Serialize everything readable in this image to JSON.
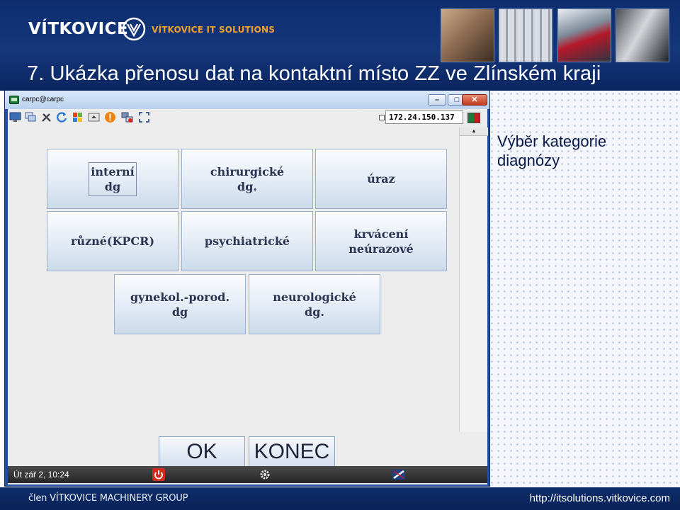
{
  "slide": {
    "logo_text": "VÍTKOVICE",
    "logo_sub": "VÍTKOVICE IT SOLUTIONS",
    "title": "7. Ukázka přenosu dat na kontaktní místo ZZ ve Zlínském kraji",
    "side_text": "Výběr kategorie diagnózy",
    "footer_left": "člen VÍTKOVICE MACHINERY GROUP",
    "footer_right": "http://itsolutions.vitkovice.com"
  },
  "window": {
    "title": "carpc@carpc",
    "controls": {
      "minimize": "–",
      "maximize": "□",
      "close": "✕"
    },
    "ip_address": "172.24.150.137",
    "toolbar_icons": [
      "monitor-icon",
      "windows-icon",
      "tools-icon",
      "refresh-icon",
      "windows-flag-icon",
      "alert-icon",
      "network-icon",
      "fullscreen-icon"
    ],
    "categories": [
      {
        "label": "interní\ndg"
      },
      {
        "label": "chirurgické\ndg."
      },
      {
        "label": "úraz"
      },
      {
        "label": "různé(KPCR)"
      },
      {
        "label": "psychiatrické"
      },
      {
        "label": "krvácení\nneúrazové"
      },
      {
        "label": "gynekol.-porod.\ndg"
      },
      {
        "label": "neurologické\ndg."
      }
    ],
    "buttons": {
      "ok": "OK",
      "konec": "KONEC"
    },
    "status_time": "Út zář  2, 10:24",
    "status_icons": [
      "power-icon",
      "settings-gear-icon",
      "keyboard-layout-icon"
    ]
  },
  "colors": {
    "header_bg": "#15377c",
    "accent_orange": "#f2a227",
    "window_border": "#1f4f9e",
    "button_text": "#2b3450"
  }
}
